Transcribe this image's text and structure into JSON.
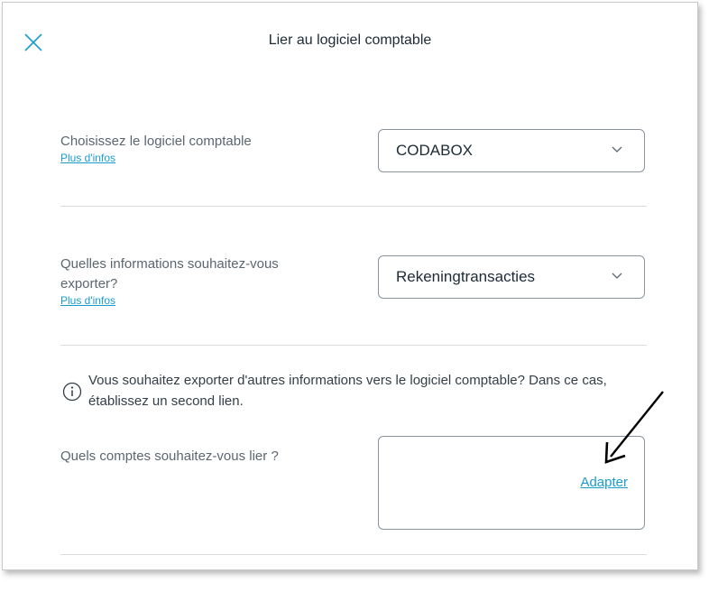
{
  "dialog": {
    "title": "Lier au logiciel comptable",
    "close_icon": "close-icon"
  },
  "software": {
    "label": "Choisissez le logiciel comptable",
    "more_info": "Plus d'infos",
    "selected": "CODABOX"
  },
  "export": {
    "label": "Quelles informations souhaitez-vous exporter?",
    "more_info": "Plus d'infos",
    "selected": "Rekeningtransacties"
  },
  "info": {
    "icon": "info-icon",
    "text": "Vous souhaitez exporter d'autres informations vers le logiciel comptable? Dans ce cas, établissez un second lien."
  },
  "accounts": {
    "label": "Quels comptes souhaitez-vous lier ?",
    "adapt_link": "Adapter"
  },
  "colors": {
    "accent": "#1a9ccf",
    "text": "#1d2b36",
    "muted": "#5b6670"
  }
}
